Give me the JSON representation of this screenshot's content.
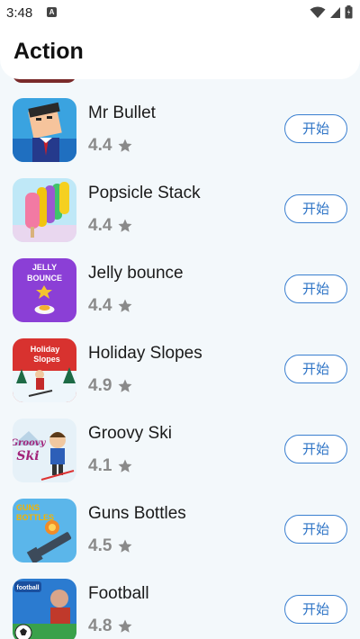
{
  "status_bar": {
    "time": "3:48",
    "app_badge": "A"
  },
  "header": {
    "title": "Action"
  },
  "games": [
    {
      "name": "Mr Bullet",
      "rating": "4.4",
      "button": "开始",
      "icon": "mr-bullet-icon"
    },
    {
      "name": "Popsicle Stack",
      "rating": "4.4",
      "button": "开始",
      "icon": "popsicle-stack-icon"
    },
    {
      "name": "Jelly bounce",
      "rating": "4.4",
      "button": "开始",
      "icon": "jelly-bounce-icon",
      "icon_text": [
        "JELLY",
        "BOUNCE"
      ]
    },
    {
      "name": "Holiday Slopes",
      "rating": "4.9",
      "button": "开始",
      "icon": "holiday-slopes-icon",
      "icon_text": [
        "Holiday",
        "Slopes"
      ]
    },
    {
      "name": "Groovy Ski",
      "rating": "4.1",
      "button": "开始",
      "icon": "groovy-ski-icon",
      "icon_text": [
        "Groovy",
        "Ski"
      ]
    },
    {
      "name": "Guns Bottles",
      "rating": "4.5",
      "button": "开始",
      "icon": "guns-bottles-icon",
      "icon_text": [
        "GUNS",
        "BOTTLES"
      ]
    },
    {
      "name": "Football",
      "rating": "4.8",
      "button": "开始",
      "icon": "football-icon",
      "icon_text": [
        "football"
      ]
    }
  ],
  "colors": {
    "accent": "#2e74c6",
    "rating_text": "#8a8a8a",
    "background": "#f3f8fb"
  }
}
